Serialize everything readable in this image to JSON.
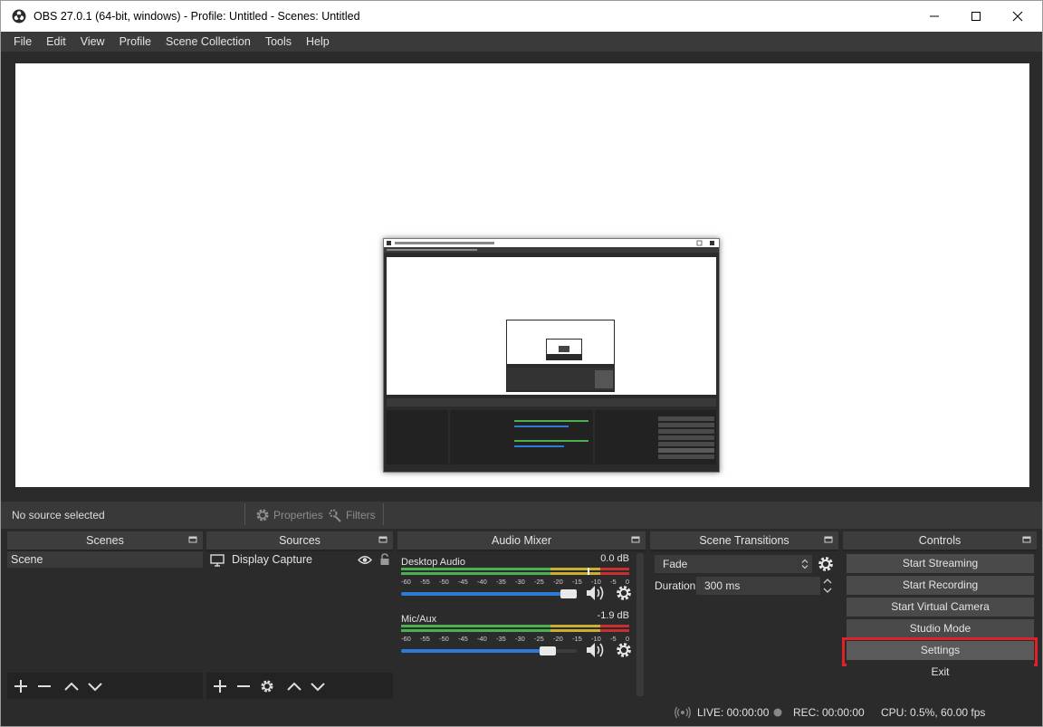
{
  "window": {
    "title": "OBS 27.0.1 (64-bit, windows) - Profile: Untitled - Scenes: Untitled",
    "icons": [
      "obs-logo-icon",
      "minimize-icon",
      "maximize-icon",
      "close-icon"
    ]
  },
  "menu": [
    "File",
    "Edit",
    "View",
    "Profile",
    "Scene Collection",
    "Tools",
    "Help"
  ],
  "source_bar": {
    "no_source": "No source selected",
    "properties": "Properties",
    "filters": "Filters"
  },
  "scenes": {
    "title": "Scenes",
    "items": [
      "Scene"
    ]
  },
  "sources": {
    "title": "Sources",
    "items": [
      "Display Capture"
    ]
  },
  "mixer": {
    "title": "Audio Mixer",
    "scale": [
      "-60",
      "-55",
      "-50",
      "-45",
      "-40",
      "-35",
      "-30",
      "-25",
      "-20",
      "-15",
      "-10",
      "-5",
      "0"
    ],
    "channels": [
      {
        "name": "Desktop Audio",
        "db": "0.0 dB",
        "volume": 1.0
      },
      {
        "name": "Mic/Aux",
        "db": "-1.9 dB",
        "volume": 0.88
      }
    ]
  },
  "transitions": {
    "title": "Scene Transitions",
    "selected": "Fade",
    "duration_label": "Duration",
    "duration_value": "300 ms"
  },
  "controls": {
    "title": "Controls",
    "buttons": [
      "Start Streaming",
      "Start Recording",
      "Start Virtual Camera",
      "Studio Mode",
      "Settings",
      "Exit"
    ],
    "highlighted": "Settings",
    "highlight_color": "#e0202a"
  },
  "status": {
    "live": "LIVE: 00:00:00",
    "rec": "REC: 00:00:00",
    "cpu": "CPU: 0.5%, 60.00 fps"
  },
  "colors": {
    "accent": "#2c7bd6",
    "meter_green": "#4caf50",
    "meter_yellow": "#c8b030",
    "meter_red": "#c83030"
  }
}
